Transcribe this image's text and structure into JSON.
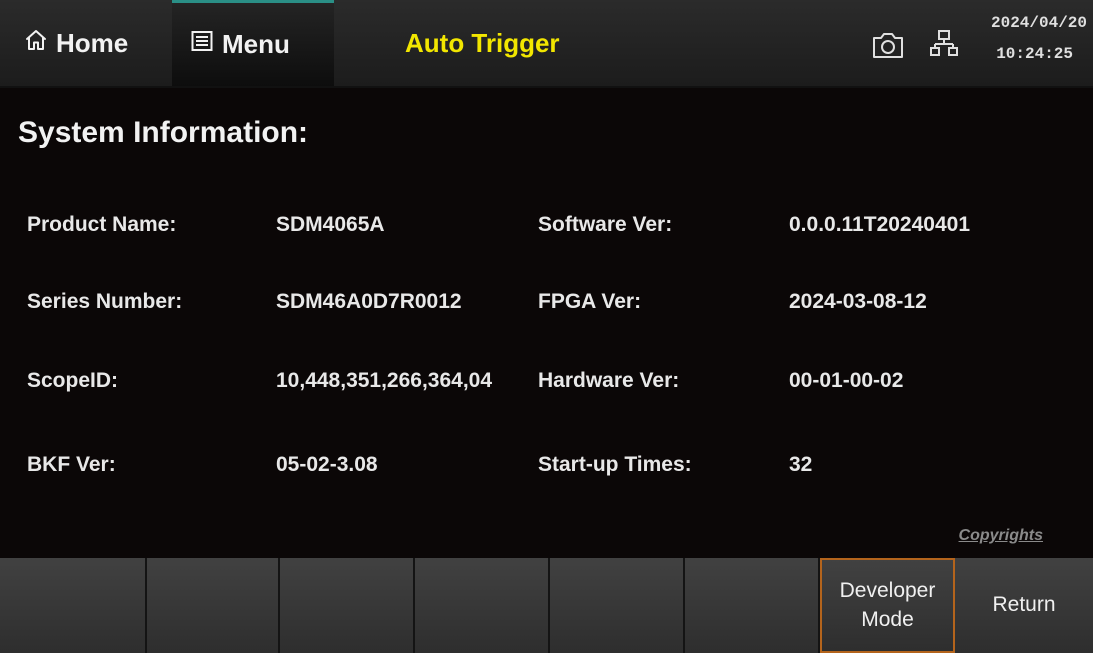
{
  "topbar": {
    "home_label": "Home",
    "menu_label": "Menu",
    "trigger_label": "Auto Trigger",
    "date": "2024/04/20",
    "time": "10:24:25",
    "icons": [
      "home-icon",
      "menu-icon",
      "camera-icon",
      "network-icon"
    ]
  },
  "section_title": "System Information:",
  "info": {
    "rows": [
      {
        "label1": "Product Name:",
        "value1": "SDM4065A",
        "label2": "Software Ver:",
        "value2": "0.0.0.11T20240401"
      },
      {
        "label1": "Series Number:",
        "value1": "SDM46A0D7R0012",
        "label2": "FPGA Ver:",
        "value2": "2024-03-08-12"
      },
      {
        "label1": "ScopeID:",
        "value1": "10,448,351,266,364,04",
        "label2": "Hardware Ver:",
        "value2": "00-01-00-02"
      },
      {
        "label1": "BKF Ver:",
        "value1": "05-02-3.08",
        "label2": "Start-up Times:",
        "value2": "32"
      }
    ]
  },
  "copyrights_label": "Copyrights",
  "softkeys": {
    "developer_line1": "Developer",
    "developer_line2": "Mode",
    "return_label": "Return"
  },
  "colors": {
    "background": "#0b0707",
    "trigger_text": "#f2e600",
    "menu_accent": "#2a8f86",
    "developer_border": "#b4641c"
  }
}
